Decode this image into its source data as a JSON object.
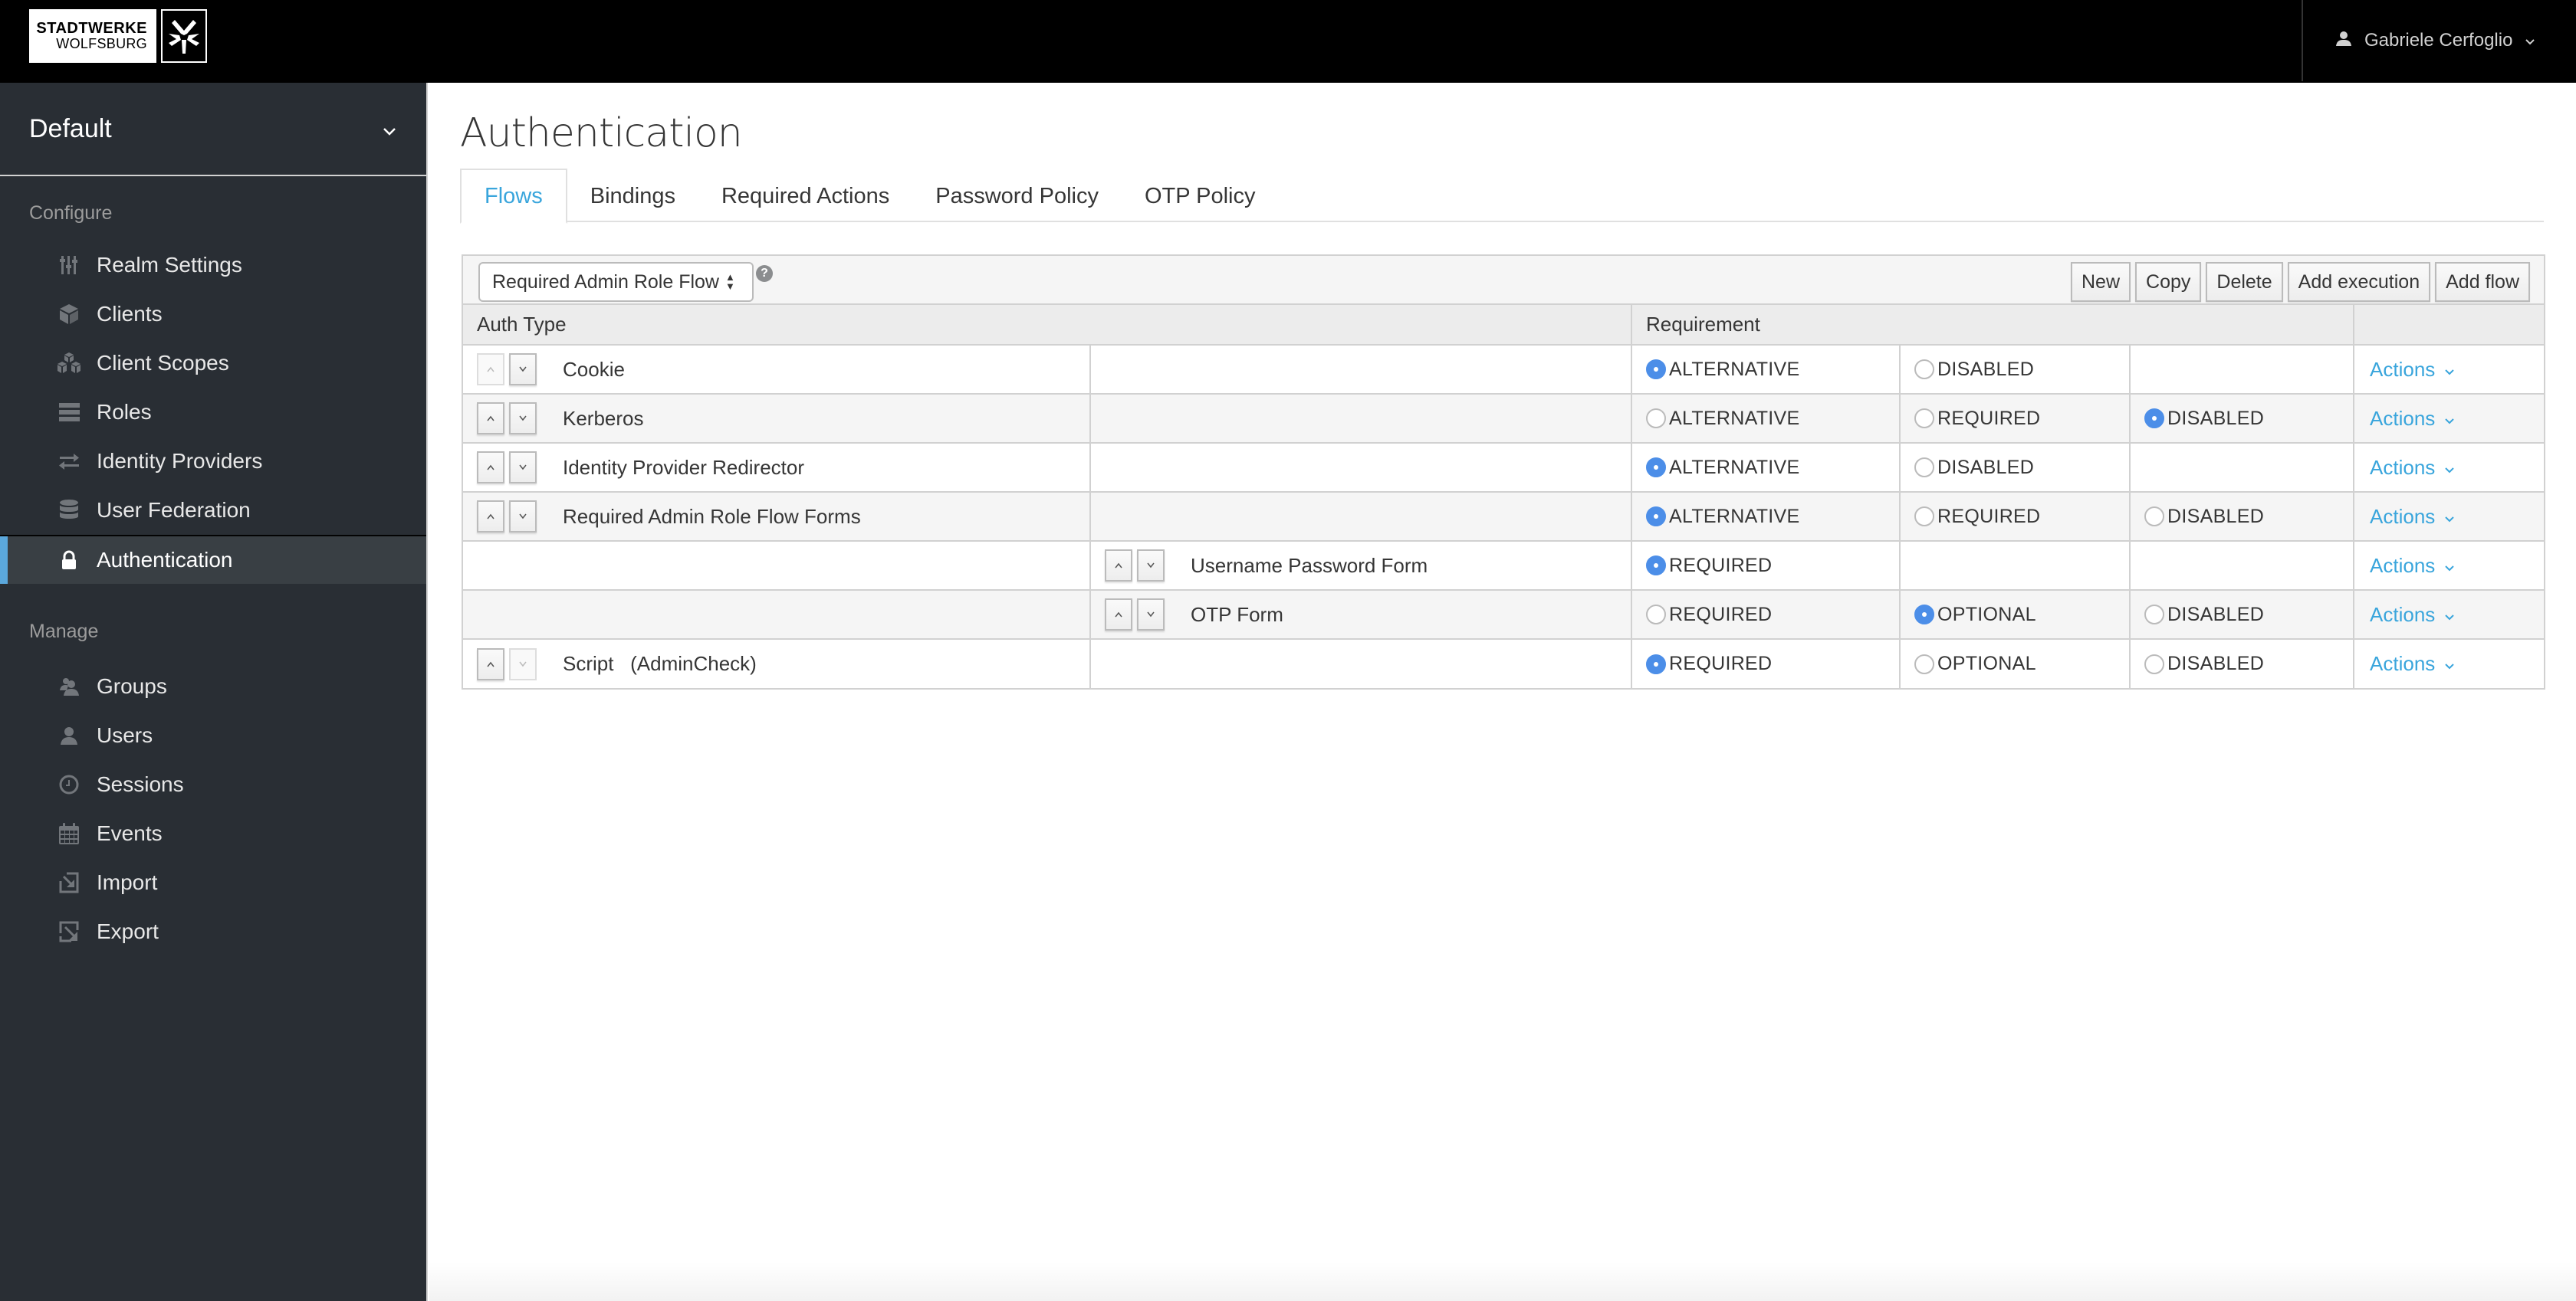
{
  "navbar": {
    "logo_line1": "STADTWERKE",
    "logo_line2": "WOLFSBURG",
    "user_name": "Gabriele Cerfoglio",
    "user_icon": "user-icon",
    "user_menu_icon": "chevron-down-icon"
  },
  "sidebar": {
    "realm": "Default",
    "configure_label": "Configure",
    "configure_items": [
      {
        "label": "Realm Settings",
        "icon": "sliders-icon"
      },
      {
        "label": "Clients",
        "icon": "cube-icon"
      },
      {
        "label": "Client Scopes",
        "icon": "cubes-icon"
      },
      {
        "label": "Roles",
        "icon": "server-icon"
      },
      {
        "label": "Identity Providers",
        "icon": "exchange-icon"
      },
      {
        "label": "User Federation",
        "icon": "database-icon"
      },
      {
        "label": "Authentication",
        "icon": "lock-icon",
        "active": true
      }
    ],
    "manage_label": "Manage",
    "manage_items": [
      {
        "label": "Groups",
        "icon": "users-icon"
      },
      {
        "label": "Users",
        "icon": "user-icon"
      },
      {
        "label": "Sessions",
        "icon": "clock-icon"
      },
      {
        "label": "Events",
        "icon": "calendar-icon"
      },
      {
        "label": "Import",
        "icon": "import-icon"
      },
      {
        "label": "Export",
        "icon": "export-icon"
      }
    ]
  },
  "main": {
    "title": "Authentication",
    "tabs": [
      {
        "label": "Flows",
        "active": true
      },
      {
        "label": "Bindings"
      },
      {
        "label": "Required Actions"
      },
      {
        "label": "Password Policy"
      },
      {
        "label": "OTP Policy"
      }
    ],
    "flow_select": {
      "value": "Required Admin Role Flow",
      "help_icon": "question-circle-icon"
    },
    "toolbar_buttons": [
      "New",
      "Copy",
      "Delete",
      "Add execution",
      "Add flow"
    ],
    "table": {
      "headers": {
        "auth_type": "Auth Type",
        "requirement": "Requirement"
      },
      "actions_label": "Actions",
      "rows": [
        {
          "name": "Cookie",
          "level": 0,
          "up_enabled": false,
          "down_enabled": true,
          "options": [
            "ALTERNATIVE",
            "DISABLED",
            ""
          ],
          "selected": "ALTERNATIVE"
        },
        {
          "name": "Kerberos",
          "level": 0,
          "up_enabled": true,
          "down_enabled": true,
          "options": [
            "ALTERNATIVE",
            "REQUIRED",
            "DISABLED"
          ],
          "selected": "DISABLED"
        },
        {
          "name": "Identity Provider Redirector",
          "level": 0,
          "up_enabled": true,
          "down_enabled": true,
          "options": [
            "ALTERNATIVE",
            "DISABLED",
            ""
          ],
          "selected": "ALTERNATIVE"
        },
        {
          "name": "Required Admin Role Flow Forms",
          "level": 0,
          "up_enabled": true,
          "down_enabled": true,
          "options": [
            "ALTERNATIVE",
            "REQUIRED",
            "DISABLED"
          ],
          "selected": "ALTERNATIVE"
        },
        {
          "name": "Username Password Form",
          "level": 1,
          "up_enabled": true,
          "down_enabled": true,
          "options": [
            "REQUIRED",
            "",
            ""
          ],
          "selected": "REQUIRED"
        },
        {
          "name": "OTP Form",
          "level": 1,
          "up_enabled": true,
          "down_enabled": true,
          "options": [
            "REQUIRED",
            "OPTIONAL",
            "DISABLED"
          ],
          "selected": "OPTIONAL"
        },
        {
          "name": "Script   (AdminCheck)",
          "level": 0,
          "up_enabled": true,
          "down_enabled": false,
          "options": [
            "REQUIRED",
            "OPTIONAL",
            "DISABLED"
          ],
          "selected": "REQUIRED"
        }
      ]
    }
  },
  "colors": {
    "accent": "#39a5dc",
    "radio_selected": "#4c8ee8",
    "sidebar_bg": "#292e34",
    "navbar_bg": "#000000"
  }
}
